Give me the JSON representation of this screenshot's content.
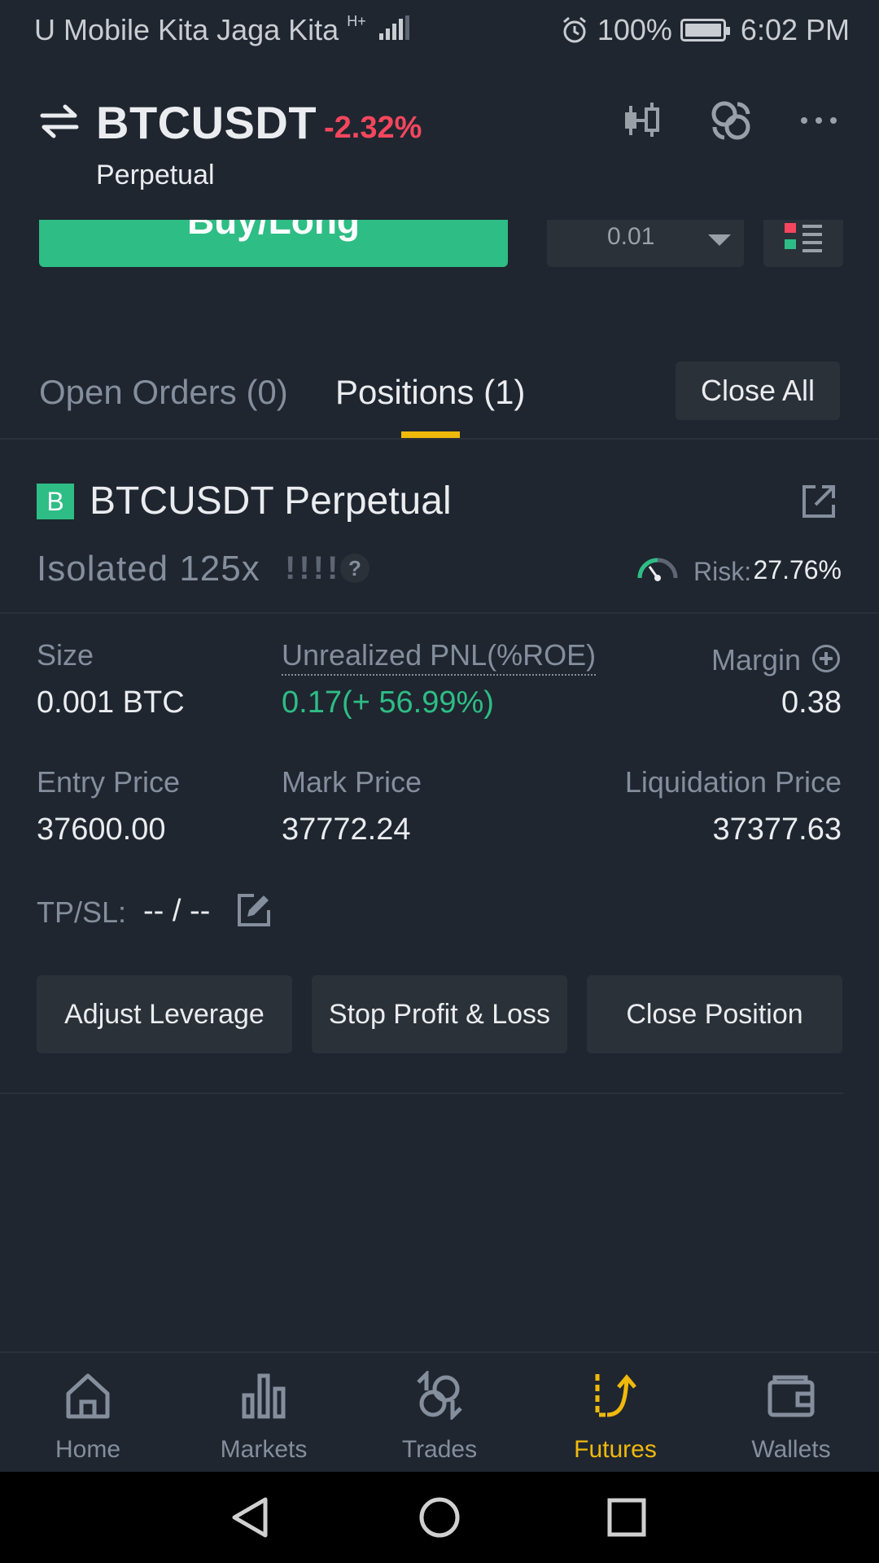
{
  "status_bar": {
    "carrier": "U Mobile Kita Jaga Kita",
    "network": "H+",
    "battery": "100%",
    "time": "6:02 PM"
  },
  "header": {
    "pair": "BTCUSDT",
    "change": "-2.32%",
    "contract_type": "Perpetual",
    "icons": [
      "swap-arrows-icon",
      "candlestick-chart-icon",
      "link-icon",
      "more-icon"
    ]
  },
  "order_strip": {
    "buy_label": "Buy/Long",
    "quantity": "0.01"
  },
  "tabs": {
    "open_orders": "Open Orders (0)",
    "positions": "Positions (1)",
    "close_all": "Close All"
  },
  "position": {
    "badge": "B",
    "title": "BTCUSDT Perpetual",
    "margin_mode": "Isolated 125x",
    "leverage_bars": "!!!!",
    "help": "?",
    "risk_label": "Risk:",
    "risk_value": "27.76%",
    "size_label": "Size",
    "size_value": "0.001 BTC",
    "pnl_label": "Unrealized PNL(%ROE)",
    "pnl_value": "0.17(+ 56.99%)",
    "margin_label": "Margin",
    "margin_value": "0.38",
    "entry_label": "Entry Price",
    "entry_value": "37600.00",
    "mark_label": "Mark Price",
    "mark_value": "37772.24",
    "liq_label": "Liquidation Price",
    "liq_value": "37377.63",
    "tpsl_label": "TP/SL:",
    "tpsl_value": "-- / --"
  },
  "actions": {
    "adjust_leverage": "Adjust Leverage",
    "stop_profit_loss": "Stop Profit & Loss",
    "close_position": "Close Position"
  },
  "bottom_nav": [
    {
      "label": "Home",
      "icon": "home-icon"
    },
    {
      "label": "Markets",
      "icon": "markets-icon"
    },
    {
      "label": "Trades",
      "icon": "trades-icon"
    },
    {
      "label": "Futures",
      "icon": "futures-icon"
    },
    {
      "label": "Wallets",
      "icon": "wallet-icon"
    }
  ],
  "colors": {
    "background": "#1f2630",
    "panel": "#2b3139",
    "green": "#2ebd85",
    "red": "#f6465d",
    "accent": "#f0b90b",
    "muted": "#848e9c"
  }
}
